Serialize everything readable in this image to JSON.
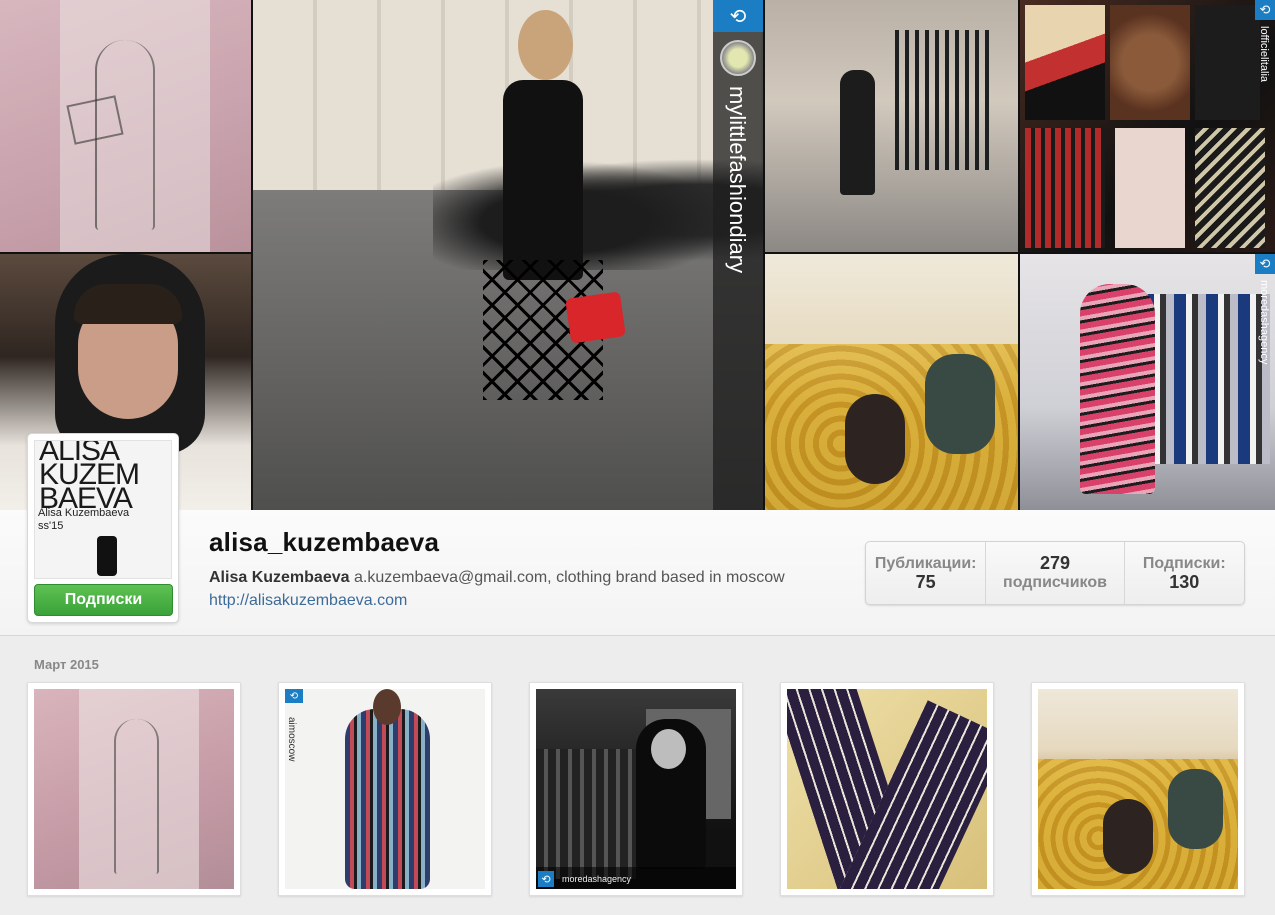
{
  "cover": {
    "credits": {
      "street": "mylittlefashiondiary",
      "racks": "lofficielitalia",
      "showroom": "moredashagency"
    }
  },
  "profile": {
    "avatar": {
      "title_lines": [
        "ALISA",
        "KUZEM",
        "BAEVA"
      ],
      "caption_lines": [
        "Alisa Kuzembaeva",
        "ss'15"
      ]
    },
    "follow_button": "Подписки",
    "username": "alisa_kuzembaeva",
    "full_name": "Alisa Kuzembaeva",
    "bio": "a.kuzembaeva@gmail.com, clothing brand based in moscow",
    "website": "http://alisakuzembaeva.com"
  },
  "stats": {
    "posts": {
      "label": "Публикации:",
      "value": "75"
    },
    "followers": {
      "label": "подписчиков",
      "value": "279"
    },
    "following": {
      "label": "Подписки:",
      "value": "130"
    }
  },
  "feed": {
    "month": "Март 2015",
    "items": [
      {
        "kind": "sketch"
      },
      {
        "kind": "dress",
        "credit": "aimoscow"
      },
      {
        "kind": "bw",
        "credit": "moredashagency"
      },
      {
        "kind": "stripes"
      },
      {
        "kind": "bananas"
      }
    ]
  },
  "colors": {
    "follow_green": "#3aa23a",
    "repost_blue": "#1b7ec4",
    "link_blue": "#3d6b99"
  },
  "icons": {
    "repost": "repost-icon"
  }
}
